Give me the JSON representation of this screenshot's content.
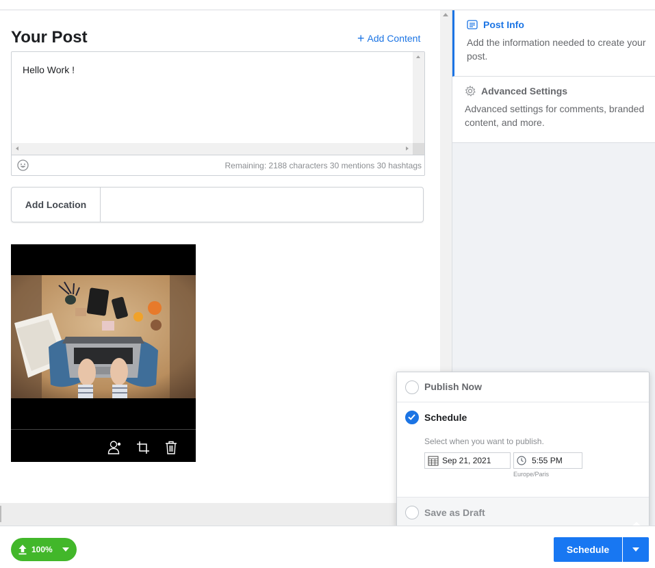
{
  "post": {
    "title": "Your Post",
    "add_content_label": "Add Content",
    "text": "Hello Work !",
    "remaining": "Remaining: 2188 characters 30 mentions 30 hashtags"
  },
  "location": {
    "label": "Add Location",
    "value": ""
  },
  "media": {
    "icons": [
      "tag-people-icon",
      "crop-icon",
      "trash-icon"
    ]
  },
  "sidebar": {
    "items": [
      {
        "title": "Post Info",
        "description": "Add the information needed to create your post.",
        "icon": "post-info-icon",
        "active": true
      },
      {
        "title": "Advanced Settings",
        "description": "Advanced settings for comments, branded content, and more.",
        "icon": "gear-icon",
        "active": false
      }
    ]
  },
  "publish_options": {
    "publish_now": "Publish Now",
    "schedule": "Schedule",
    "schedule_hint": "Select when you want to publish.",
    "date": "Sep 21, 2021",
    "time": "5:55 PM",
    "timezone": "Europe/Paris",
    "save_as_draft": "Save as Draft",
    "selected": "Schedule"
  },
  "footer": {
    "upload_progress": "100%",
    "schedule_button": "Schedule"
  },
  "colors": {
    "accent": "#1b74e4",
    "button_blue": "#1877f2",
    "upload_green": "#42b72a"
  }
}
